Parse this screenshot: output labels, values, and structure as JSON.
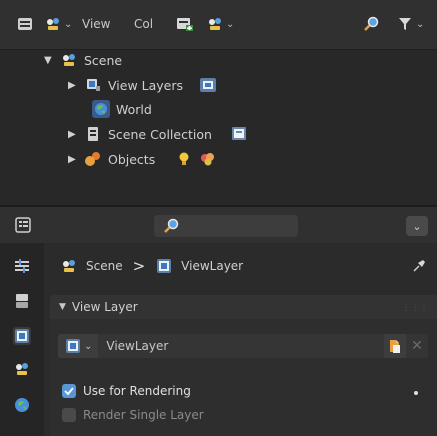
{
  "outliner": {
    "menu": {
      "view": "View",
      "col": "Col"
    },
    "tree": {
      "scene": "Scene",
      "view_layers": "View Layers",
      "world": "World",
      "scene_collection": "Scene Collection",
      "objects": "Objects"
    }
  },
  "properties": {
    "breadcrumb": {
      "scene": "Scene",
      "separator": ">",
      "view_layer": "ViewLayer"
    },
    "panel": {
      "title": "View Layer"
    },
    "view_layer_field": {
      "value": "ViewLayer"
    },
    "options": {
      "use_for_rendering": {
        "label": "Use for Rendering",
        "checked": true
      },
      "render_single_layer": {
        "label": "Render Single Layer",
        "checked": false
      }
    }
  },
  "colors": {
    "accent_blue": "#4a86c8",
    "checkbox_blue": "#5a96d6",
    "panel_bg": "#2b2b2b",
    "header_bg": "#303030"
  },
  "icons": [
    "editor-type-icon",
    "scene-icon",
    "new-collection-icon",
    "filter-icon",
    "search-icon",
    "world-icon",
    "view-layer-icon",
    "collection-icon",
    "object-icon",
    "light-icon",
    "material-icon",
    "pin-icon",
    "copy-icon",
    "close-icon"
  ]
}
